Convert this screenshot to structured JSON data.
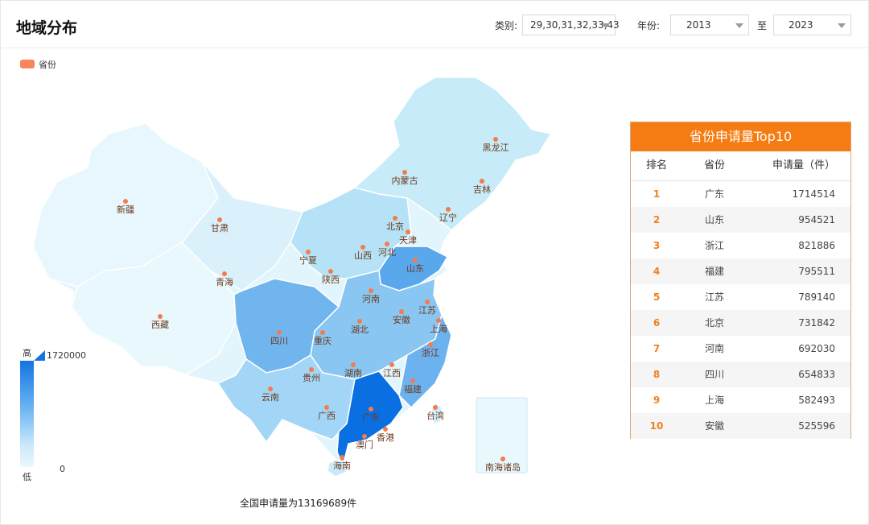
{
  "header": {
    "title": "地域分布",
    "category_label": "类别:",
    "category_value": "29,30,31,32,33,43",
    "year_label": "年份:",
    "year_from": "2013",
    "to_label": "至",
    "year_to": "2023"
  },
  "legend": {
    "label": "省份"
  },
  "scale": {
    "high_label": "高",
    "low_label": "低",
    "max": "1720000",
    "min": "0"
  },
  "summary": "全国申请量为13169689件",
  "colors": {
    "accent": "#f57c12",
    "marker": "#f57b4a",
    "scale_high": "#1474e0",
    "scale_low": "#ecf8fd"
  },
  "top10": {
    "title": "省份申请量Top10",
    "columns": [
      "排名",
      "省份",
      "申请量（件）"
    ],
    "rows": [
      {
        "rank": "1",
        "province": "广东",
        "value": "1714514"
      },
      {
        "rank": "2",
        "province": "山东",
        "value": "954521"
      },
      {
        "rank": "3",
        "province": "浙江",
        "value": "821886"
      },
      {
        "rank": "4",
        "province": "福建",
        "value": "795511"
      },
      {
        "rank": "5",
        "province": "江苏",
        "value": "789140"
      },
      {
        "rank": "6",
        "province": "北京",
        "value": "731842"
      },
      {
        "rank": "7",
        "province": "河南",
        "value": "692030"
      },
      {
        "rank": "8",
        "province": "四川",
        "value": "654833"
      },
      {
        "rank": "9",
        "province": "上海",
        "value": "582493"
      },
      {
        "rank": "10",
        "province": "安徽",
        "value": "525596"
      }
    ]
  },
  "map": {
    "provinces": [
      "黑龙江",
      "内蒙古",
      "吉林",
      "辽宁",
      "新疆",
      "甘肃",
      "北京",
      "天津",
      "河北",
      "宁夏",
      "山西",
      "山东",
      "青海",
      "陕西",
      "河南",
      "江苏",
      "安徽",
      "上海",
      "西藏",
      "四川",
      "重庆",
      "湖北",
      "浙江",
      "贵州",
      "湖南",
      "江西",
      "福建",
      "云南",
      "广西",
      "广东",
      "台湾",
      "香港",
      "澳门",
      "海南",
      "南海诸岛"
    ]
  }
}
